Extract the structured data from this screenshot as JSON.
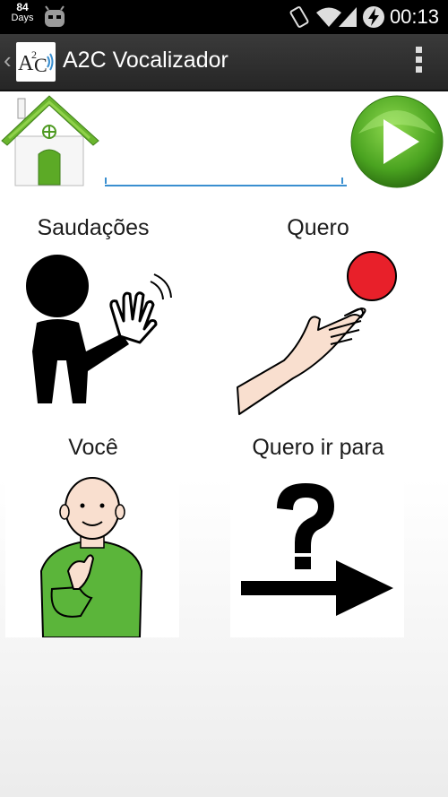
{
  "status_bar": {
    "days_count": "84",
    "days_label": "Days",
    "time": "00:13",
    "icons": [
      "android-icon",
      "vibrate-icon",
      "wifi-icon",
      "signal-icon",
      "battery-charging-icon"
    ]
  },
  "action_bar": {
    "title": "A2C Vocalizador",
    "logo_text": "A2C",
    "icons": [
      "app-logo",
      "overflow-menu-icon"
    ]
  },
  "controls": {
    "home_icon": "home-icon",
    "play_icon": "play-icon",
    "text_value": ""
  },
  "cards": [
    {
      "label": "Saudações",
      "icon": "waving-person-icon"
    },
    {
      "label": "Quero",
      "icon": "hand-reaching-ball-icon"
    },
    {
      "label": "Você",
      "icon": "person-pointing-icon"
    },
    {
      "label": "Quero ir para",
      "icon": "question-arrow-icon"
    }
  ],
  "colors": {
    "action_bar": "#2e2e2e",
    "accent_underline": "#3a8fd0",
    "play_green": "#4aa320",
    "ball_red": "#e8202a",
    "shirt_green": "#5bb53a"
  }
}
